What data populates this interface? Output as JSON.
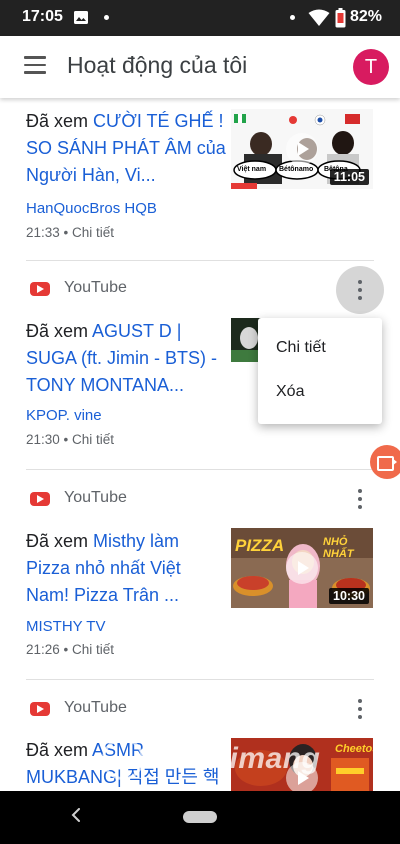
{
  "status_bar": {
    "time": "17:05",
    "battery_pct": "82%"
  },
  "app_bar": {
    "title": "Hoạt động của tôi",
    "avatar_letter": "T"
  },
  "feed": [
    {
      "verb": "Đã xem",
      "title": "CƯỜI TÉ GHẾ ! SO SÁNH PHÁT ÂM của Người Hàn, Vi...",
      "channel": "HanQuocBros HQB",
      "time": "21:33",
      "detail_link": "Chi tiết",
      "duration": "11:05",
      "thumb_labels": [
        "Việt nam",
        "Bétônamo",
        "Bêtôna"
      ]
    },
    {
      "source": "YouTube",
      "verb": "Đã xem",
      "title": "AGUST D | SUGA (ft. Jimin - BTS) - TONY MONTANA...",
      "channel": "KPOP. vine",
      "time": "21:30",
      "detail_link": "Chi tiết"
    },
    {
      "source": "YouTube",
      "verb": "Đã xem",
      "title": "Misthy làm Pizza nhỏ nhất Việt Nam! Pizza Trân ...",
      "channel": "MISTHY TV",
      "time": "21:26",
      "detail_link": "Chi tiết",
      "duration": "10:30",
      "thumb_text": "PIZZA",
      "thumb_text2": "NHỎ NHẤT"
    },
    {
      "source": "YouTube",
      "verb": "Đã xem",
      "title": "ASMR MUKBANG| 직접 만든 핵",
      "thumb_text": "Cheetos"
    }
  ],
  "popup_menu": {
    "items": [
      "Chi tiết",
      "Xóa"
    ]
  },
  "watermark": "uantrimang",
  "icons": [
    "menu-icon",
    "youtube-icon",
    "more-vert-icon",
    "play-icon",
    "screen-record-icon",
    "back-icon",
    "home-icon",
    "wifi-icon",
    "battery-icon",
    "image-icon"
  ],
  "colors": {
    "link": "#1a5fd6",
    "avatar": "#d81b60",
    "youtube": "#e53935",
    "record": "#f06a4b"
  }
}
